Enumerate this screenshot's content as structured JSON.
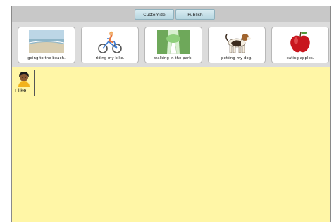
{
  "toolbar": {
    "customize_label": "Customize",
    "publish_label": "Publish"
  },
  "tiles": [
    {
      "label": "going to the beach.",
      "icon": "beach-icon"
    },
    {
      "label": "riding my bike.",
      "icon": "bike-icon"
    },
    {
      "label": "walking in the park.",
      "icon": "park-icon"
    },
    {
      "label": "petting my dog.",
      "icon": "dog-icon"
    },
    {
      "label": "eating apples.",
      "icon": "apple-icon"
    }
  ],
  "sentence": {
    "label": "I like",
    "icon": "child-avatar-icon"
  },
  "colors": {
    "workspace": "#fff6a6",
    "toolbar": "#c8c8c8",
    "button": "#c4e0ea"
  }
}
